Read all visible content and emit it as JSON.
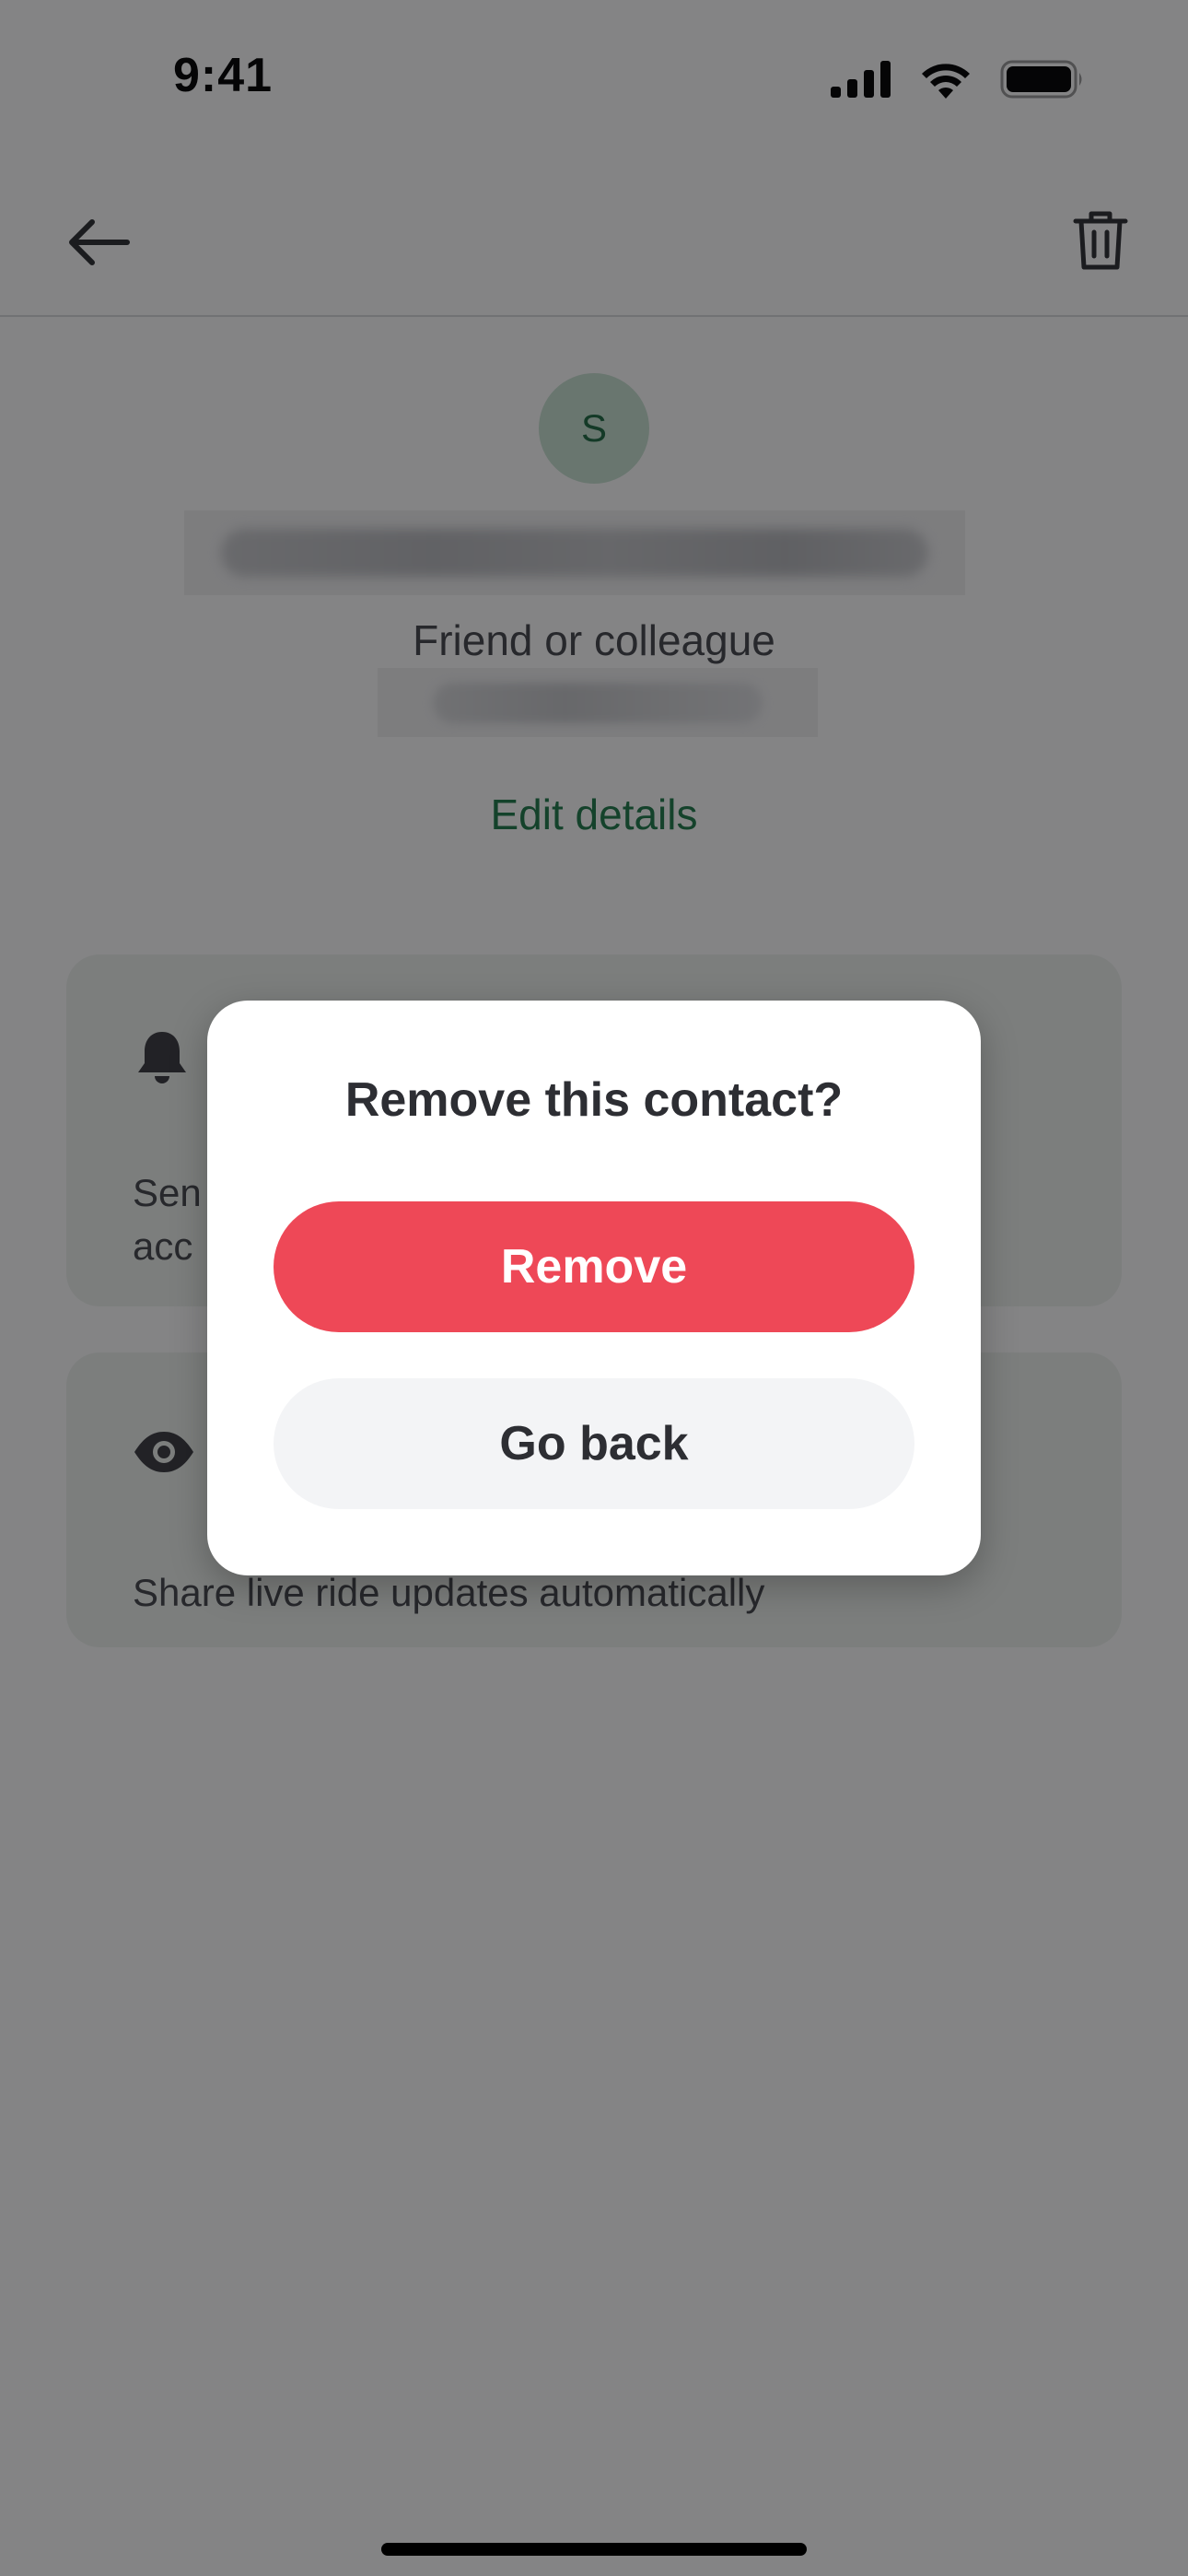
{
  "status_bar": {
    "time": "9:41",
    "icons": [
      "cellular-signal-icon",
      "wifi-icon",
      "battery-icon"
    ]
  },
  "header": {
    "back_icon": "arrow-left-icon",
    "delete_icon": "trash-icon"
  },
  "contact": {
    "avatar_initial": "S",
    "relationship": "Friend or colleague",
    "edit_label": "Edit details"
  },
  "cards": {
    "alerts": {
      "icon": "bell-icon",
      "text_visible": "Sen\nacc"
    },
    "live_updates": {
      "icon": "eye-icon",
      "text": "Share live ride updates automatically"
    }
  },
  "dialog": {
    "title": "Remove this contact?",
    "remove_label": "Remove",
    "back_label": "Go back"
  },
  "colors": {
    "accent_green": "#1e7a4a",
    "avatar_bg": "#c9e3d3",
    "danger_red": "#ee4857",
    "secondary_button_bg": "#f3f4f6",
    "card_bg": "#eef2ef"
  }
}
